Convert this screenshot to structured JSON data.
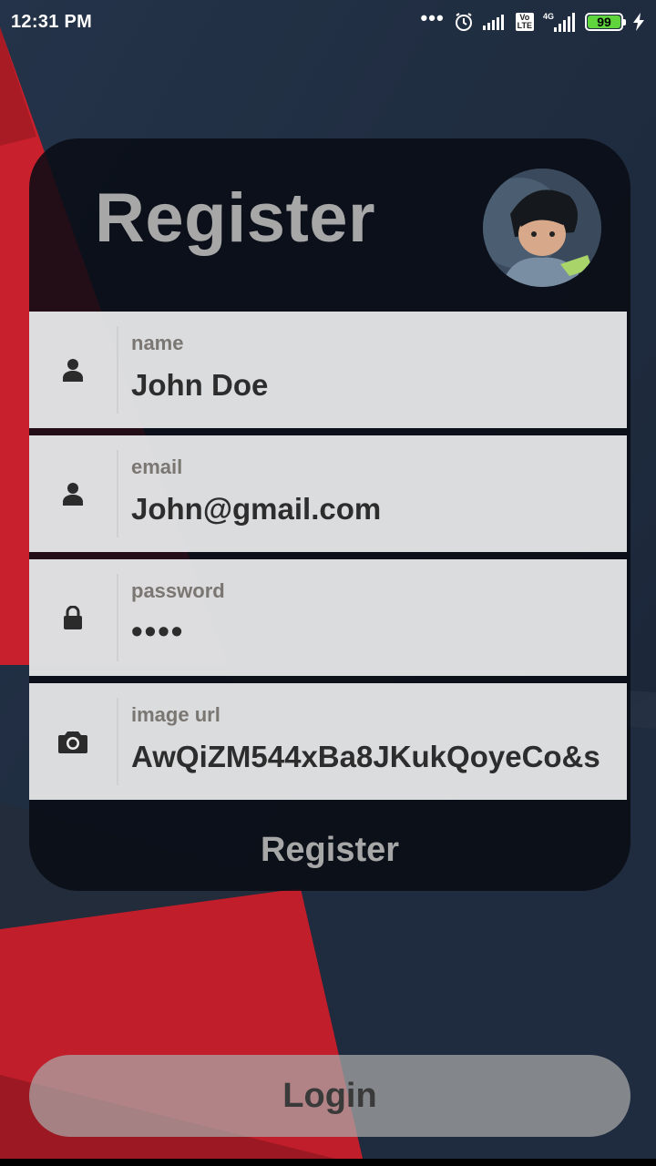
{
  "status_bar": {
    "time": "12:31 PM",
    "dots": "•••",
    "volte": "Vo\nLTE",
    "network": "4G",
    "battery": "99"
  },
  "card": {
    "title": "Register",
    "fields": [
      {
        "label": "name",
        "value": "John Doe",
        "icon": "person-icon"
      },
      {
        "label": "email",
        "value": "John@gmail.com",
        "icon": "person-icon"
      },
      {
        "label": "password",
        "value": "••••",
        "icon": "lock-icon"
      },
      {
        "label": "image url",
        "value": "AwQiZM544xBa8JKukQoyeCo&s",
        "icon": "camera-icon"
      }
    ],
    "register_button": "Register"
  },
  "login_button": "Login",
  "colors": {
    "background": "#1e2a3c",
    "red_accent": "#c8202c",
    "card": "#080c14",
    "field": "#ececee",
    "title_text": "#a7a7a7",
    "battery": "#5fd43d"
  }
}
